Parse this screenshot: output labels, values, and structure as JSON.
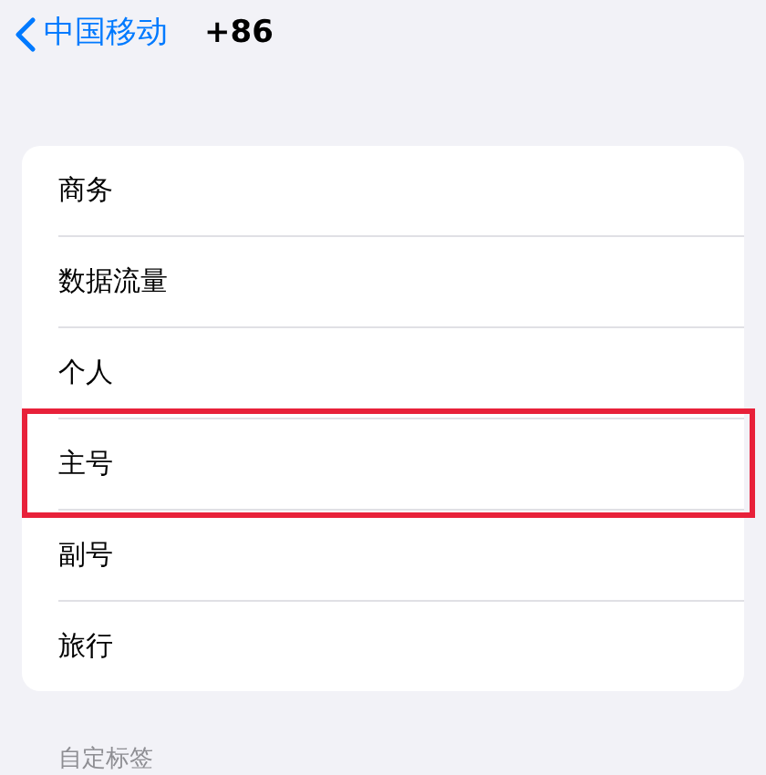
{
  "nav": {
    "back_label": "中国移动",
    "title": "+86"
  },
  "labels": [
    {
      "text": "商务",
      "highlighted": false
    },
    {
      "text": "数据流量",
      "highlighted": false
    },
    {
      "text": "个人",
      "highlighted": false
    },
    {
      "text": "主号",
      "highlighted": true
    },
    {
      "text": "副号",
      "highlighted": false
    },
    {
      "text": "旅行",
      "highlighted": false
    }
  ],
  "section_header": "自定标签"
}
